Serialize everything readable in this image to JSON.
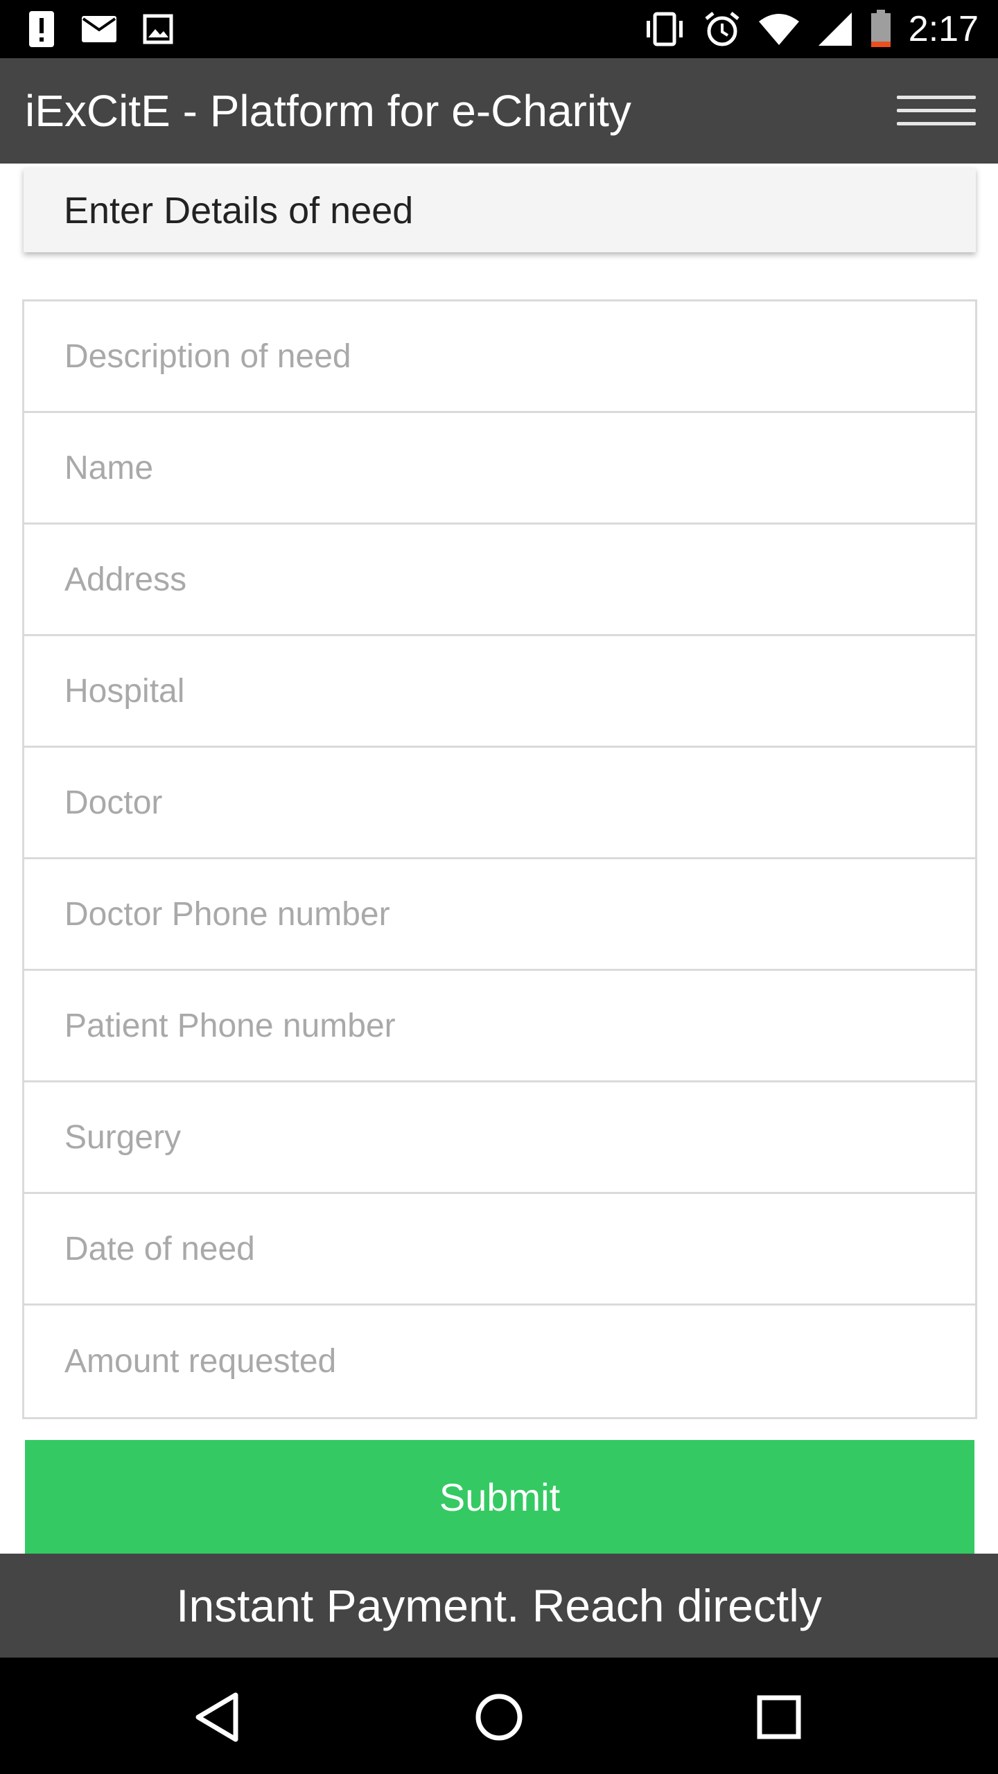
{
  "status_bar": {
    "time": "2:17",
    "left_icons": [
      "alert-icon",
      "email-icon",
      "image-icon"
    ],
    "right_icons": [
      "vibrate-icon",
      "alarm-icon",
      "wifi-icon",
      "signal-icon",
      "battery-icon"
    ]
  },
  "app_bar": {
    "title": "iExCitE - Platform for e-Charity",
    "menu_icon": "hamburger-menu-icon"
  },
  "section": {
    "title": "Enter Details of need"
  },
  "form": {
    "fields": [
      {
        "placeholder": "Description of need",
        "value": ""
      },
      {
        "placeholder": "Name",
        "value": ""
      },
      {
        "placeholder": "Address",
        "value": ""
      },
      {
        "placeholder": "Hospital",
        "value": ""
      },
      {
        "placeholder": "Doctor",
        "value": ""
      },
      {
        "placeholder": "Doctor Phone number",
        "value": ""
      },
      {
        "placeholder": "Patient Phone number",
        "value": ""
      },
      {
        "placeholder": "Surgery",
        "value": ""
      },
      {
        "placeholder": "Date of need",
        "value": ""
      },
      {
        "placeholder": "Amount requested",
        "value": ""
      }
    ],
    "submit_label": "Submit"
  },
  "footer": {
    "text": "Instant Payment. Reach directly"
  },
  "nav_bar": {
    "icons": [
      "back-icon",
      "home-icon",
      "recents-icon"
    ]
  },
  "colors": {
    "app_bar": "#454545",
    "submit": "#35c963",
    "section_card": "#f4f4f4",
    "placeholder": "#a9a9a9"
  }
}
